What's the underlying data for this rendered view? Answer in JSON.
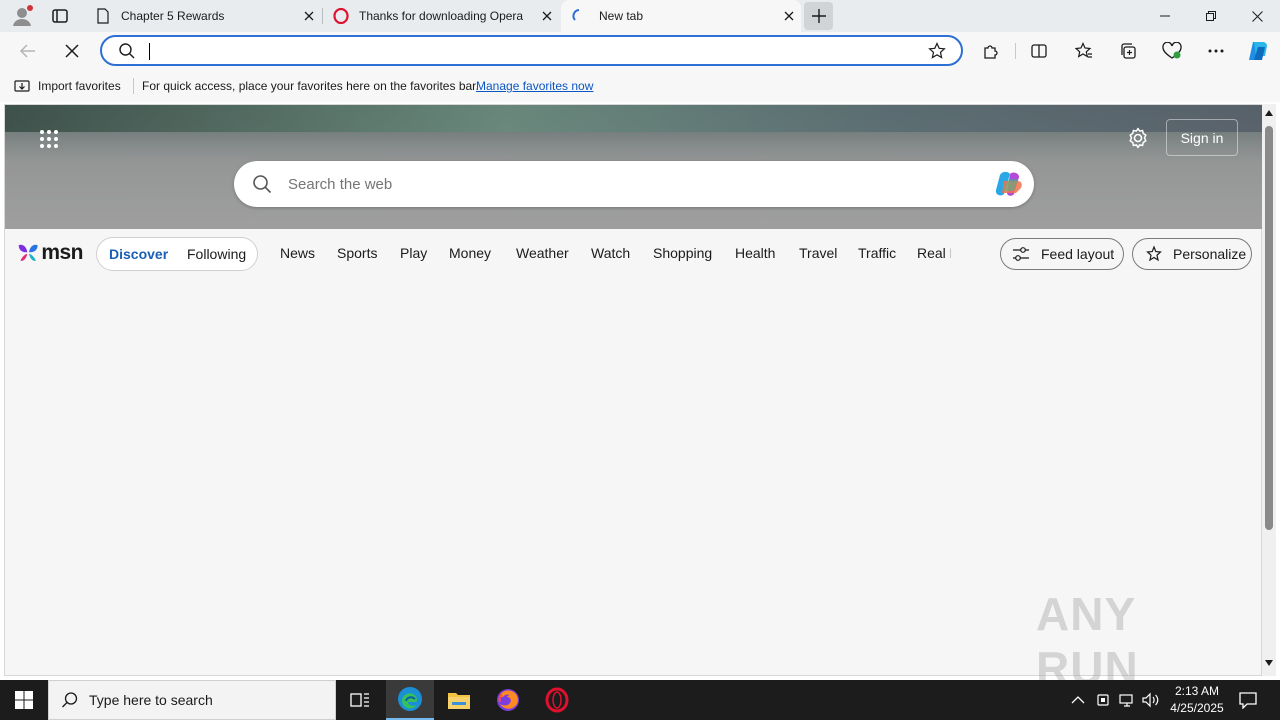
{
  "tabs": [
    {
      "title": "Chapter 5 Rewards",
      "icon": "document-icon"
    },
    {
      "title": "Thanks for downloading Opera",
      "icon": "opera-icon"
    },
    {
      "title": "New tab",
      "icon": "loading-icon"
    }
  ],
  "window_controls": [
    "minimize",
    "restore",
    "close"
  ],
  "addressbar": {
    "value": "",
    "placeholder": ""
  },
  "favbar": {
    "import_label": "Import favorites",
    "message": "For quick access, place your favorites here on the favorites bar.",
    "manage_link": "Manage favorites now"
  },
  "msn": {
    "search_placeholder": "Search the web",
    "signin_label": "Sign in",
    "logo_text": "msn",
    "feed_tabs": [
      {
        "label": "Discover",
        "active": true
      },
      {
        "label": "Following",
        "active": false
      }
    ],
    "nav_items": [
      "News",
      "Sports",
      "Play",
      "Money",
      "Weather",
      "Watch",
      "Shopping",
      "Health",
      "Travel",
      "Traffic",
      "Real E"
    ],
    "feed_layout_label": "Feed layout",
    "personalize_label": "Personalize"
  },
  "taskbar": {
    "search_placeholder": "Type here to search",
    "time": "2:13 AM",
    "date": "4/25/2025"
  },
  "watermark": "ANY RUN",
  "colors": {
    "accent": "#2d6fd4",
    "link": "#0b57c2",
    "taskbar": "#1c1c1c",
    "discover": "#1a5fb4"
  }
}
